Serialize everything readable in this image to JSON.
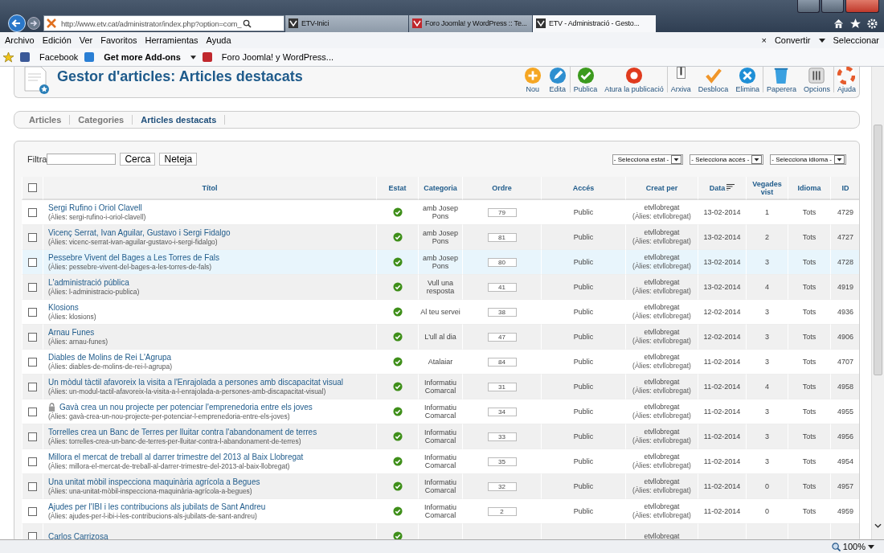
{
  "browser": {
    "address": "http://www.etv.cat/administrator/index.php?option=com_",
    "tabs": [
      {
        "label": "ETV-Inici",
        "selected": false
      },
      {
        "label": "Foro Joomla! y WordPress :: Te...",
        "selected": false
      },
      {
        "label": "ETV - Administració - Gesto...",
        "selected": true
      }
    ],
    "menu": [
      "Archivo",
      "Edición",
      "Ver",
      "Favoritos",
      "Herramientas",
      "Ayuda"
    ],
    "menu_right": {
      "close": "×",
      "convert": "Convertir",
      "select": "Seleccionar"
    },
    "favorites": [
      {
        "label": "Facebook",
        "bold": false
      },
      {
        "label": "Get more Add-ons",
        "bold": true
      },
      {
        "label": "Foro Joomla! y WordPress...",
        "bold": false
      }
    ],
    "zoom": "100%"
  },
  "page": {
    "title": "Gestor d'articles: Articles destacats",
    "toolbar": [
      {
        "label": "Nou",
        "divider_before": false
      },
      {
        "label": "Edita",
        "divider_before": false
      },
      {
        "label": "Publica",
        "divider_before": true
      },
      {
        "label": "Atura la publicació",
        "divider_before": false
      },
      {
        "label": "Arxiva",
        "divider_before": true
      },
      {
        "label": "Desbloca",
        "divider_before": false
      },
      {
        "label": "Elimina",
        "divider_before": false
      },
      {
        "label": "Paperera",
        "divider_before": true
      },
      {
        "label": "Opcions",
        "divider_before": false
      },
      {
        "label": "Ajuda",
        "divider_before": true
      }
    ],
    "tabs": [
      {
        "label": "Articles",
        "selected": false
      },
      {
        "label": "Categories",
        "selected": false
      },
      {
        "label": "Articles destacats",
        "selected": true
      }
    ],
    "filter": {
      "label": "Filtra",
      "search_button": "Cerca",
      "clear_button": "Neteja"
    },
    "selects": [
      "- Selecciona estat -",
      "- Selecciona accés -",
      "- Selecciona idioma -"
    ]
  },
  "table": {
    "select_all_checked": false,
    "columns": [
      "Títol",
      "Estat",
      "Categoria",
      "Ordre",
      "Accés",
      "Creat per",
      "Data",
      "Vegades vist",
      "Idioma",
      "ID"
    ],
    "rows": [
      {
        "title": "Sergi Rufino i Oriol Clavell",
        "alias": "(Àlies: sergi-rufino-i-oriol-clavell)",
        "locked": false,
        "checked": false,
        "published": true,
        "highlighted": false,
        "category": "amb Josep Pons",
        "order": "79",
        "access": "Public",
        "author": "etvllobregat",
        "author_alias": "(Àlies: etvllobregat)",
        "date": "13-02-2014",
        "hits": "1",
        "language": "Tots",
        "id": "4729"
      },
      {
        "title": "Vicenç Serrat, Ivan Aguilar, Gustavo i Sergi Fidalgo",
        "alias": "(Àlies: vicenc-serrat-ivan-aguilar-gustavo-i-sergi-fidalgo)",
        "locked": false,
        "checked": false,
        "published": true,
        "highlighted": false,
        "category": "amb Josep Pons",
        "order": "81",
        "access": "Public",
        "author": "etvllobregat",
        "author_alias": "(Àlies: etvllobregat)",
        "date": "13-02-2014",
        "hits": "2",
        "language": "Tots",
        "id": "4727"
      },
      {
        "title": "Pessebre Vivent del Bages a Les Torres de Fals",
        "alias": "(Àlies: pessebre-vivent-del-bages-a-les-torres-de-fals)",
        "locked": false,
        "checked": false,
        "published": true,
        "highlighted": true,
        "category": "amb Josep Pons",
        "order": "80",
        "access": "Public",
        "author": "etvllobregat",
        "author_alias": "(Àlies: etvllobregat)",
        "date": "13-02-2014",
        "hits": "3",
        "language": "Tots",
        "id": "4728"
      },
      {
        "title": "L'administració pública",
        "alias": "(Àlies: l-administracio-publica)",
        "locked": false,
        "checked": false,
        "published": true,
        "highlighted": false,
        "category": "Vull una resposta",
        "order": "41",
        "access": "Public",
        "author": "etvllobregat",
        "author_alias": "(Àlies: etvllobregat)",
        "date": "13-02-2014",
        "hits": "4",
        "language": "Tots",
        "id": "4919"
      },
      {
        "title": "Klosions",
        "alias": "(Àlies: klosions)",
        "locked": false,
        "checked": false,
        "published": true,
        "highlighted": false,
        "category": "Al teu servei",
        "order": "38",
        "access": "Public",
        "author": "etvllobregat",
        "author_alias": "(Àlies: etvllobregat)",
        "date": "12-02-2014",
        "hits": "3",
        "language": "Tots",
        "id": "4936"
      },
      {
        "title": "Arnau Funes",
        "alias": "(Àlies: arnau-funes)",
        "locked": false,
        "checked": false,
        "published": true,
        "highlighted": false,
        "category": "L'ull al dia",
        "order": "47",
        "access": "Public",
        "author": "etvllobregat",
        "author_alias": "(Àlies: etvllobregat)",
        "date": "12-02-2014",
        "hits": "3",
        "language": "Tots",
        "id": "4906"
      },
      {
        "title": "Diables de Molins de Rei L'Agrupa",
        "alias": "(Àlies: diables-de-molins-de-rei-l-agrupa)",
        "locked": false,
        "checked": false,
        "published": true,
        "highlighted": false,
        "category": "Atalaiar",
        "order": "84",
        "access": "Public",
        "author": "etvllobregat",
        "author_alias": "(Àlies: etvllobregat)",
        "date": "11-02-2014",
        "hits": "3",
        "language": "Tots",
        "id": "4707"
      },
      {
        "title": "Un mòdul tàctil afavoreix la visita a l'Enrajolada a persones amb discapacitat visual",
        "alias": "(Àlies: un-modul-tactil-afavoreix-la-visita-a-l-enrajolada-a-persones-amb-discapacitat-visual)",
        "locked": false,
        "checked": false,
        "published": true,
        "highlighted": false,
        "category": "Informatiu Comarcal",
        "order": "31",
        "access": "Public",
        "author": "etvllobregat",
        "author_alias": "(Àlies: etvllobregat)",
        "date": "11-02-2014",
        "hits": "4",
        "language": "Tots",
        "id": "4958"
      },
      {
        "title": "Gavà crea un nou projecte per potenciar l'emprenedoria entre els joves",
        "alias": "(Àlies: gavà-crea-un-nou-projecte-per-potenciar-l-emprenedoria-entre-els-joves)",
        "locked": true,
        "checked": false,
        "published": true,
        "highlighted": false,
        "category": "Informatiu Comarcal",
        "order": "34",
        "access": "Public",
        "author": "etvllobregat",
        "author_alias": "(Àlies: etvllobregat)",
        "date": "11-02-2014",
        "hits": "3",
        "language": "Tots",
        "id": "4955"
      },
      {
        "title": "Torrelles crea un Banc de Terres per lluitar contra l'abandonament de terres",
        "alias": "(Àlies: torrelles-crea-un-banc-de-terres-per-lluitar-contra-l-abandonament-de-terres)",
        "locked": false,
        "checked": false,
        "published": true,
        "highlighted": false,
        "category": "Informatiu Comarcal",
        "order": "33",
        "access": "Public",
        "author": "etvllobregat",
        "author_alias": "(Àlies: etvllobregat)",
        "date": "11-02-2014",
        "hits": "3",
        "language": "Tots",
        "id": "4956"
      },
      {
        "title": "Millora el mercat de treball al darrer trimestre del 2013 al Baix Llobregat",
        "alias": "(Àlies: millora-el-mercat-de-treball-al-darrer-trimestre-del-2013-al-baix-llobregat)",
        "locked": false,
        "checked": false,
        "published": true,
        "highlighted": false,
        "category": "Informatiu Comarcal",
        "order": "35",
        "access": "Public",
        "author": "etvllobregat",
        "author_alias": "(Àlies: etvllobregat)",
        "date": "11-02-2014",
        "hits": "3",
        "language": "Tots",
        "id": "4954"
      },
      {
        "title": "Una unitat mòbil inspecciona maquinària agrícola a Begues",
        "alias": "(Àlies: una-unitat-mòbil-inspecciona-maquinària-agrícola-a-begues)",
        "locked": false,
        "checked": false,
        "published": true,
        "highlighted": false,
        "category": "Informatiu Comarcal",
        "order": "32",
        "access": "Public",
        "author": "etvllobregat",
        "author_alias": "(Àlies: etvllobregat)",
        "date": "11-02-2014",
        "hits": "0",
        "language": "Tots",
        "id": "4957"
      },
      {
        "title": "Ajudes per l'IBI i les contribucions als jubilats de Sant Andreu",
        "alias": "(Àlies: ajudes-per-l-ibi-i-les-contribucions-als-jubilats-de-sant-andreu)",
        "locked": false,
        "checked": false,
        "published": true,
        "highlighted": false,
        "category": "Informatiu Comarcal",
        "order": "2",
        "access": "Public",
        "author": "etvllobregat",
        "author_alias": "(Àlies: etvllobregat)",
        "date": "11-02-2014",
        "hits": "0",
        "language": "Tots",
        "id": "4959"
      },
      {
        "title": "Carlos Carrizosa",
        "checked": false,
        "published": true,
        "highlighted": false,
        "author": "etvllobregat"
      }
    ]
  }
}
